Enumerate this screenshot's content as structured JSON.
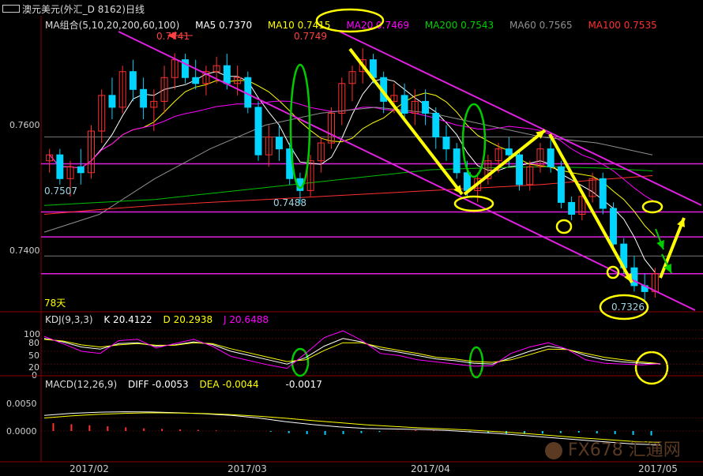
{
  "window": {
    "title": "澳元美元(外汇_D 8162)日线"
  },
  "legend": {
    "ma_group": "MA组合(5,10,20,200,60,100)",
    "ma5": "MA5 0.7370",
    "ma10": "MA10 0.7415",
    "ma20": "MA20 0.7469",
    "ma200": "MA200 0.7543",
    "ma60": "MA60 0.7565",
    "ma100": "MA100 0.7535"
  },
  "kdj": {
    "label": "KDJ(9,3,3)",
    "k": "K  20.4122",
    "d": "D  20.2938",
    "j": "J  20.6488"
  },
  "macd": {
    "label": "MACD(12,26,9)",
    "diff": "DIFF  -0.0053",
    "dea": "DEA  -0.0044",
    "macd_val": "-0.0017"
  },
  "annotations": {
    "high1": "0.7741",
    "high2": "0.7749",
    "low_left": "0.7507",
    "low_mid": "0.7488",
    "low_right": "0.7326",
    "days": "78天"
  },
  "watermark": "FX678 汇通网",
  "colors": {
    "ma5": "#ffffff",
    "ma10": "#ffff00",
    "ma20": "#ff00ff",
    "ma200": "#00c000",
    "ma60": "#909090",
    "ma100": "#ff3030",
    "up": "#ff3030",
    "down": "#00d4ff",
    "channel": "#e020e0"
  },
  "chart_data": {
    "type": "candlestick",
    "title": "澳元美元(外汇_D 8162)日线",
    "ylim": [
      0.731,
      0.778
    ],
    "y_ticks": [
      "0.7600",
      "0.7400"
    ],
    "x_ticks": [
      "2017/02",
      "2017/03",
      "2017/04",
      "2017/05"
    ],
    "candles": [
      [
        0.756,
        0.758,
        0.754,
        0.757
      ],
      [
        0.757,
        0.758,
        0.752,
        0.753
      ],
      [
        0.753,
        0.756,
        0.75,
        0.755
      ],
      [
        0.755,
        0.758,
        0.752,
        0.754
      ],
      [
        0.754,
        0.762,
        0.753,
        0.761
      ],
      [
        0.761,
        0.768,
        0.759,
        0.767
      ],
      [
        0.767,
        0.77,
        0.763,
        0.765
      ],
      [
        0.765,
        0.772,
        0.764,
        0.771
      ],
      [
        0.771,
        0.773,
        0.766,
        0.768
      ],
      [
        0.768,
        0.77,
        0.763,
        0.765
      ],
      [
        0.765,
        0.768,
        0.761,
        0.766
      ],
      [
        0.766,
        0.772,
        0.764,
        0.77
      ],
      [
        0.77,
        0.7741,
        0.768,
        0.773
      ],
      [
        0.773,
        0.774,
        0.769,
        0.77
      ],
      [
        0.77,
        0.773,
        0.768,
        0.769
      ],
      [
        0.769,
        0.772,
        0.767,
        0.771
      ],
      [
        0.771,
        0.7735,
        0.769,
        0.772
      ],
      [
        0.772,
        0.774,
        0.768,
        0.769
      ],
      [
        0.769,
        0.772,
        0.767,
        0.77
      ],
      [
        0.77,
        0.771,
        0.764,
        0.765
      ],
      [
        0.765,
        0.766,
        0.756,
        0.757
      ],
      [
        0.757,
        0.762,
        0.755,
        0.76
      ],
      [
        0.76,
        0.762,
        0.756,
        0.758
      ],
      [
        0.758,
        0.759,
        0.752,
        0.753
      ],
      [
        0.753,
        0.754,
        0.7488,
        0.751
      ],
      [
        0.751,
        0.757,
        0.75,
        0.756
      ],
      [
        0.756,
        0.76,
        0.754,
        0.759
      ],
      [
        0.759,
        0.765,
        0.758,
        0.764
      ],
      [
        0.764,
        0.77,
        0.762,
        0.769
      ],
      [
        0.769,
        0.772,
        0.766,
        0.771
      ],
      [
        0.771,
        0.7749,
        0.769,
        0.773
      ],
      [
        0.773,
        0.774,
        0.769,
        0.77
      ],
      [
        0.77,
        0.771,
        0.764,
        0.766
      ],
      [
        0.766,
        0.769,
        0.764,
        0.767
      ],
      [
        0.767,
        0.769,
        0.763,
        0.764
      ],
      [
        0.764,
        0.768,
        0.762,
        0.766
      ],
      [
        0.766,
        0.768,
        0.762,
        0.764
      ],
      [
        0.764,
        0.765,
        0.758,
        0.76
      ],
      [
        0.76,
        0.762,
        0.756,
        0.758
      ],
      [
        0.758,
        0.759,
        0.753,
        0.754
      ],
      [
        0.754,
        0.756,
        0.75,
        0.751
      ],
      [
        0.751,
        0.754,
        0.749,
        0.753
      ],
      [
        0.753,
        0.757,
        0.752,
        0.756
      ],
      [
        0.756,
        0.759,
        0.754,
        0.758
      ],
      [
        0.758,
        0.76,
        0.755,
        0.757
      ],
      [
        0.757,
        0.758,
        0.751,
        0.752
      ],
      [
        0.752,
        0.756,
        0.751,
        0.755
      ],
      [
        0.755,
        0.759,
        0.754,
        0.758
      ],
      [
        0.758,
        0.76,
        0.754,
        0.755
      ],
      [
        0.755,
        0.756,
        0.748,
        0.749
      ],
      [
        0.749,
        0.75,
        0.746,
        0.747
      ],
      [
        0.747,
        0.751,
        0.746,
        0.75
      ],
      [
        0.75,
        0.754,
        0.749,
        0.753
      ],
      [
        0.753,
        0.754,
        0.747,
        0.748
      ],
      [
        0.748,
        0.749,
        0.741,
        0.742
      ],
      [
        0.742,
        0.743,
        0.737,
        0.738
      ],
      [
        0.738,
        0.74,
        0.734,
        0.735
      ],
      [
        0.735,
        0.737,
        0.7326,
        0.734
      ],
      [
        0.734,
        0.738,
        0.733,
        0.737
      ]
    ]
  }
}
